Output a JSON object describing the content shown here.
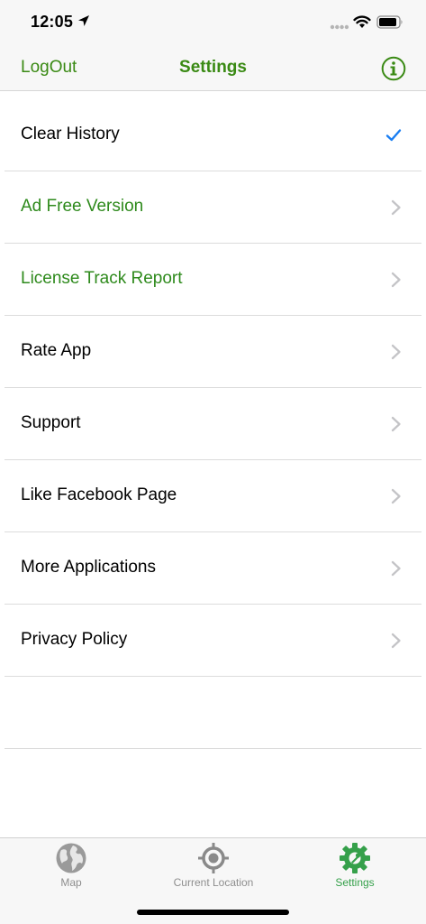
{
  "status_bar": {
    "time": "12:05"
  },
  "nav": {
    "left_label": "LogOut",
    "title": "Settings",
    "right_icon": "info-circle-icon",
    "tint_color": "#3a8a14"
  },
  "settings": {
    "items": [
      {
        "label": "Clear History",
        "accessory": "checkmark-icon",
        "selected": true
      },
      {
        "label": "Ad Free Version",
        "accessory": "chevron-right-icon"
      },
      {
        "label": "License Track Report",
        "accessory": "chevron-right-icon"
      },
      {
        "label": "Rate App",
        "accessory": "chevron-right-icon"
      },
      {
        "label": "Support",
        "accessory": "chevron-right-icon"
      },
      {
        "label": "Like Facebook Page",
        "accessory": "chevron-right-icon"
      },
      {
        "label": "More Applications",
        "accessory": "chevron-right-icon"
      },
      {
        "label": "Privacy Policy",
        "accessory": "chevron-right-icon"
      }
    ],
    "highlight_color": "#2e8a1c",
    "check_color": "#1a7ef2"
  },
  "tabs": [
    {
      "label": "Map",
      "icon": "globe-icon",
      "active": false
    },
    {
      "label": "Current Location",
      "icon": "target-icon",
      "active": false
    },
    {
      "label": "Settings",
      "icon": "gear-icon",
      "active": true
    }
  ],
  "tab_active_color": "#35a04a"
}
